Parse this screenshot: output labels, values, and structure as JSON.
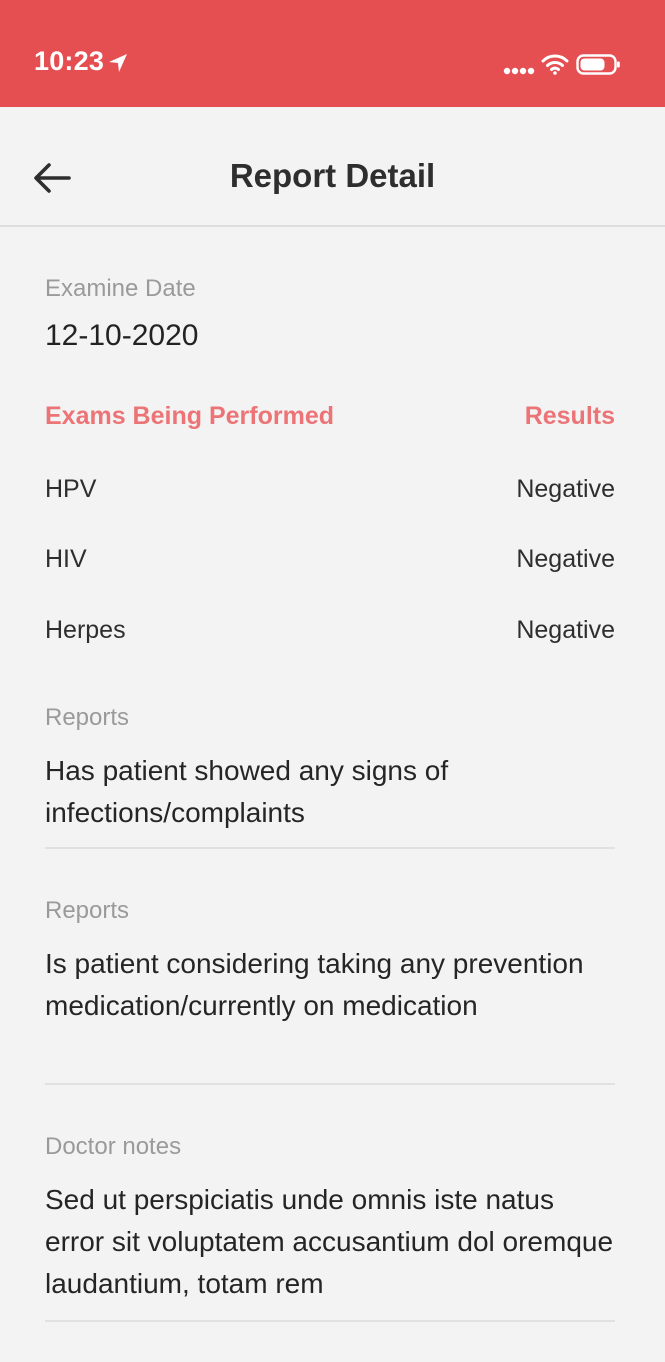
{
  "status_bar": {
    "time": "10:23",
    "background_color": "#e54f52",
    "icons": [
      "location-arrow-icon",
      "signal-dots-icon",
      "wifi-icon",
      "battery-icon"
    ]
  },
  "header": {
    "back_icon": "arrow-left-icon",
    "title": "Report Detail"
  },
  "examine": {
    "label": "Examine Date",
    "date": "12-10-2020"
  },
  "exams": {
    "header_left": "Exams Being Performed",
    "header_right": "Results",
    "accent_color": "#ec7476",
    "rows": [
      {
        "name": "HPV",
        "result": "Negative"
      },
      {
        "name": "HIV",
        "result": "Negative"
      },
      {
        "name": "Herpes",
        "result": "Negative"
      }
    ]
  },
  "reports": [
    {
      "label": "Reports",
      "text": "Has patient showed any signs of infections/complaints"
    },
    {
      "label": "Reports",
      "text": "Is patient considering taking any prevention medication/currently on medication"
    }
  ],
  "doctor_notes": {
    "label": "Doctor notes",
    "text": "Sed ut perspiciatis unde omnis iste natus error sit voluptatem accusantium dol oremque laudantium, totam rem"
  }
}
